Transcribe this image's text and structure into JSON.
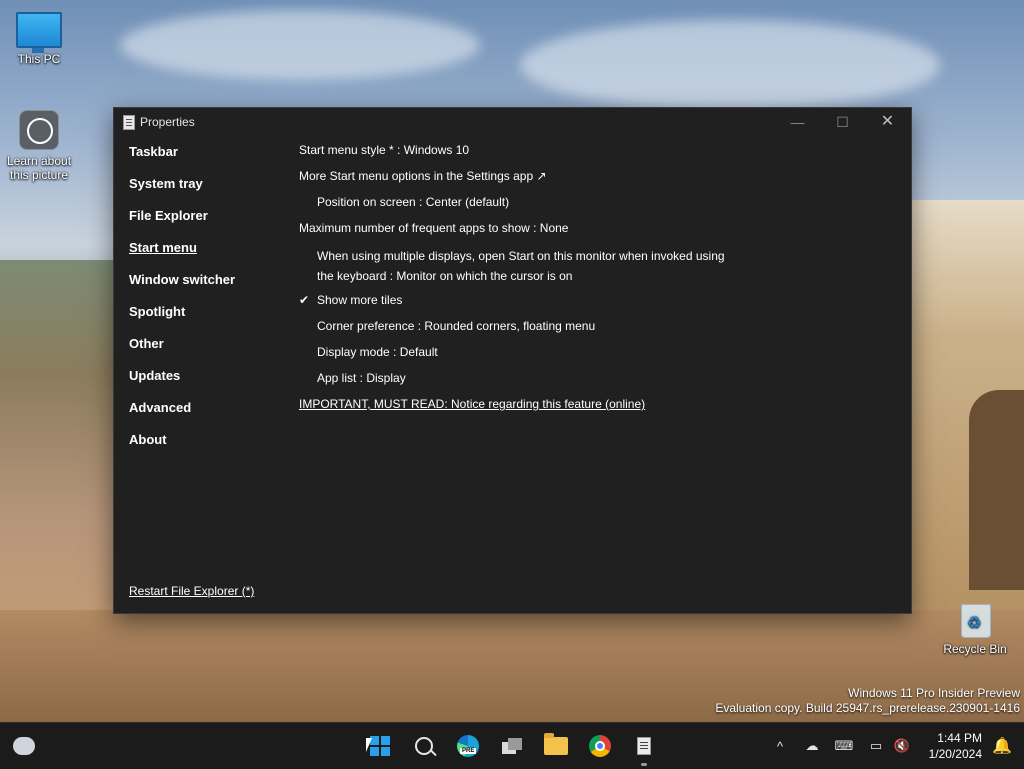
{
  "desktop": {
    "icons": [
      {
        "label": "This PC"
      },
      {
        "label": "Learn about this picture"
      },
      {
        "label": "Recycle Bin"
      }
    ],
    "watermark": {
      "line1": "Windows 11 Pro Insider Preview",
      "line2": "Evaluation copy. Build 25947.rs_prerelease.230901-1416"
    }
  },
  "window": {
    "title": "Properties",
    "controls": {
      "minimize": "—",
      "maximize": "☐",
      "close": "✕"
    },
    "sidebar": {
      "items": [
        {
          "label": "Taskbar"
        },
        {
          "label": "System tray"
        },
        {
          "label": "File Explorer"
        },
        {
          "label": "Start menu",
          "active": true
        },
        {
          "label": "Window switcher"
        },
        {
          "label": "Spotlight"
        },
        {
          "label": "Other"
        },
        {
          "label": "Updates"
        },
        {
          "label": "Advanced"
        },
        {
          "label": "About"
        }
      ],
      "restart_link": "Restart File Explorer (*)"
    },
    "content": {
      "rows": [
        "Start menu style * : Windows 10",
        "More Start menu options in the Settings app ↗",
        "Position on screen : Center (default)",
        "Maximum number of frequent apps to show : None",
        "When using multiple displays, open Start on this monitor when invoked using",
        "the keyboard : Monitor on which the cursor is on",
        "Show more tiles",
        "Corner preference : Rounded corners, floating menu",
        "Display mode : Default",
        "App list : Display",
        "IMPORTANT, MUST READ: Notice regarding this feature (online)"
      ],
      "show_more_tiles_checked": true,
      "checkmark": "✔"
    }
  },
  "taskbar": {
    "apps": [
      "weather-icon",
      "start-icon",
      "search-icon",
      "edge-pre-icon",
      "task-view-icon",
      "file-explorer-icon",
      "chrome-icon",
      "properties-app-icon"
    ],
    "edge_badge": "PRE",
    "tray": {
      "chevron": "^",
      "time": "1:44 PM",
      "date": "1/20/2024"
    }
  },
  "colors": {
    "window_bg": "#202020",
    "taskbar_bg": "#1b1b1b",
    "accent": "#2aa0ea"
  }
}
